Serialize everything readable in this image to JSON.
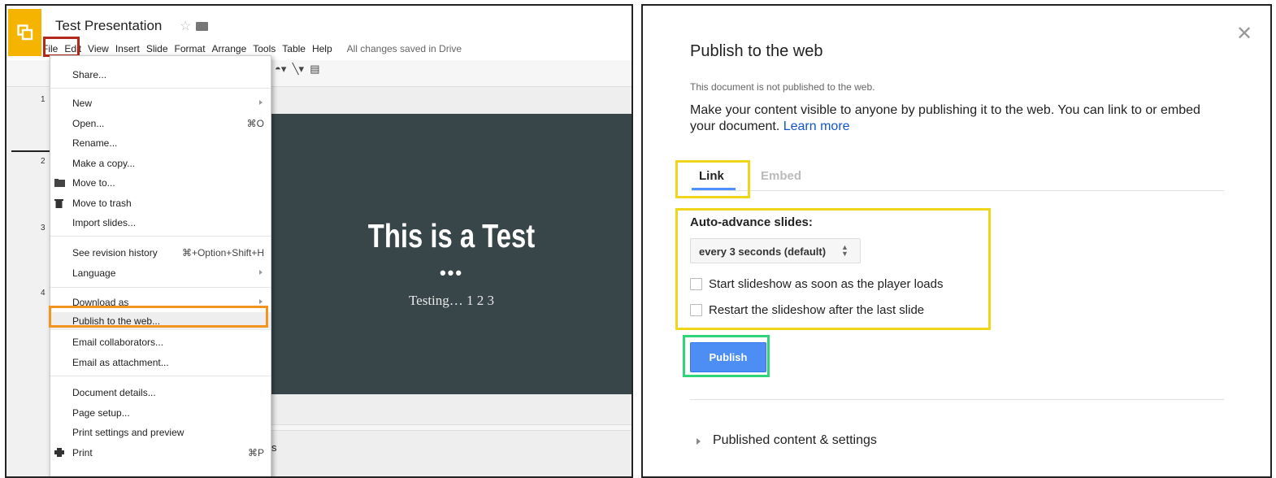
{
  "left": {
    "doc_title": "Test Presentation",
    "menubar": [
      "File",
      "Edit",
      "View",
      "Insert",
      "Slide",
      "Format",
      "Arrange",
      "Tools",
      "Table",
      "Help"
    ],
    "saved_status": "All changes saved in Drive",
    "slide_numbers": [
      "1",
      "2",
      "3",
      "4"
    ],
    "slide": {
      "title": "This is a Test",
      "dots": "•••",
      "subtitle": "Testing… 1 2 3",
      "bg_color": "#384549"
    },
    "notes_partial": "s",
    "file_menu": {
      "items": [
        {
          "label": "Share..."
        },
        {
          "label": "New",
          "submenu": true
        },
        {
          "label": "Open...",
          "shortcut": "⌘O"
        },
        {
          "label": "Rename..."
        },
        {
          "label": "Make a copy..."
        },
        {
          "label": "Move to...",
          "icon": "folder-icon"
        },
        {
          "label": "Move to trash",
          "icon": "trash-icon"
        },
        {
          "label": "Import slides..."
        },
        {
          "label": "See revision history",
          "shortcut": "⌘+Option+Shift+H"
        },
        {
          "label": "Language",
          "submenu": true
        },
        {
          "label": "Download as",
          "submenu": true
        },
        {
          "label": "Publish to the web..."
        },
        {
          "label": "Email collaborators..."
        },
        {
          "label": "Email as attachment..."
        },
        {
          "label": "Document details..."
        },
        {
          "label": "Page setup..."
        },
        {
          "label": "Print settings and preview"
        },
        {
          "label": "Print",
          "shortcut": "⌘P",
          "icon": "print-icon"
        }
      ]
    }
  },
  "dialog": {
    "title": "Publish to the web",
    "status": "This document is not published to the web.",
    "description": "Make your content visible to anyone by publishing it to the web. You can link to or embed your document.",
    "learn_more": "Learn more",
    "tabs": {
      "link": "Link",
      "embed": "Embed"
    },
    "auto_advance_label": "Auto-advance slides:",
    "auto_advance_value": "every 3 seconds (default)",
    "checkbox_start": "Start slideshow as soon as the player loads",
    "checkbox_restart": "Restart the slideshow after the last slide",
    "publish_button": "Publish",
    "published_section": "Published content & settings",
    "close_glyph": "✕"
  },
  "highlight_colors": {
    "file_menu": "#b3281c",
    "publish_item": "#f29422",
    "options": "#f0d619",
    "publish_button": "#2fd478"
  }
}
